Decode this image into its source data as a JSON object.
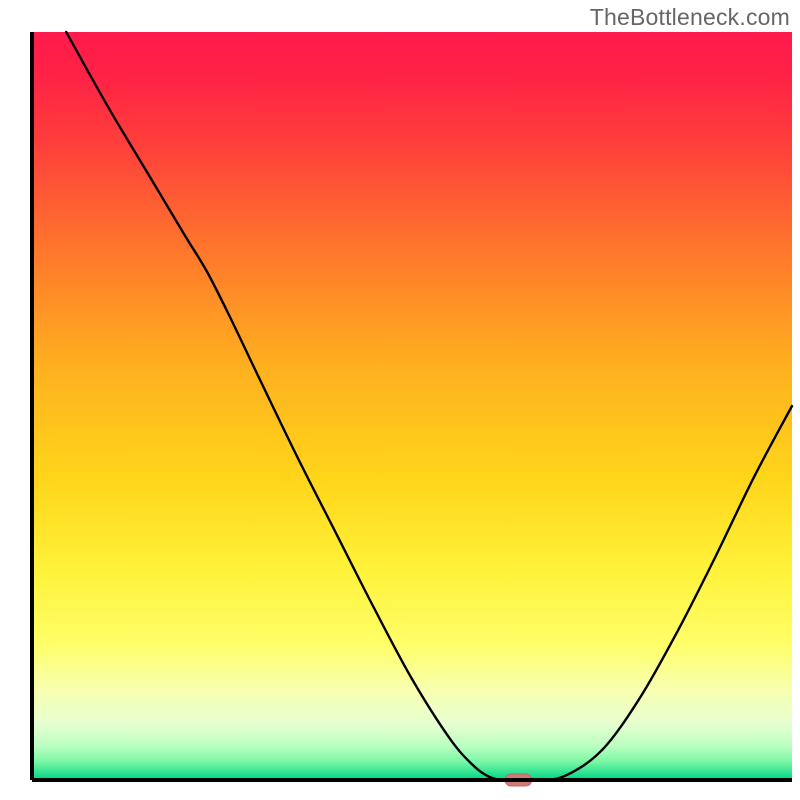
{
  "watermark": "TheBottleneck.com",
  "chart_data": {
    "type": "line",
    "title": "",
    "xlabel": "",
    "ylabel": "",
    "xlim": [
      0,
      100
    ],
    "ylim": [
      0,
      100
    ],
    "axes": {
      "left": true,
      "bottom": true,
      "right": false,
      "top": false,
      "ticks": false,
      "grid": false
    },
    "background": {
      "type": "vertical-gradient",
      "stops": [
        {
          "offset": 0.0,
          "color": "#ff1a4d"
        },
        {
          "offset": 0.06,
          "color": "#ff2346"
        },
        {
          "offset": 0.15,
          "color": "#ff3f3b"
        },
        {
          "offset": 0.3,
          "color": "#ff7a2b"
        },
        {
          "offset": 0.45,
          "color": "#ffb11f"
        },
        {
          "offset": 0.6,
          "color": "#ffd61a"
        },
        {
          "offset": 0.72,
          "color": "#fff23a"
        },
        {
          "offset": 0.82,
          "color": "#ffff6a"
        },
        {
          "offset": 0.88,
          "color": "#f8ffb0"
        },
        {
          "offset": 0.925,
          "color": "#e6ffd0"
        },
        {
          "offset": 0.955,
          "color": "#b9ffc0"
        },
        {
          "offset": 0.975,
          "color": "#7cf7a6"
        },
        {
          "offset": 0.992,
          "color": "#26e08f"
        },
        {
          "offset": 1.0,
          "color": "#00d481"
        }
      ]
    },
    "series": [
      {
        "name": "bottleneck-curve",
        "color": "#000000",
        "stroke_width": 2.4,
        "x": [
          4.5,
          10,
          15,
          20,
          23,
          26,
          30,
          35,
          40,
          45,
          50,
          55,
          58,
          60,
          62,
          66,
          70,
          75,
          80,
          85,
          90,
          95,
          100
        ],
        "y": [
          100,
          90,
          81.5,
          73,
          68,
          62,
          53.5,
          43,
          33,
          23,
          13.5,
          5.5,
          2,
          0.5,
          0,
          0,
          0.5,
          4,
          11,
          20,
          30,
          40.5,
          50
        ]
      }
    ],
    "marker": {
      "name": "selected-point",
      "x": 64,
      "y": 0,
      "shape": "rounded-rect",
      "width_pct": 3.5,
      "height_pct": 1.6,
      "fill": "#d07a77",
      "stroke": "#b96b68"
    }
  }
}
